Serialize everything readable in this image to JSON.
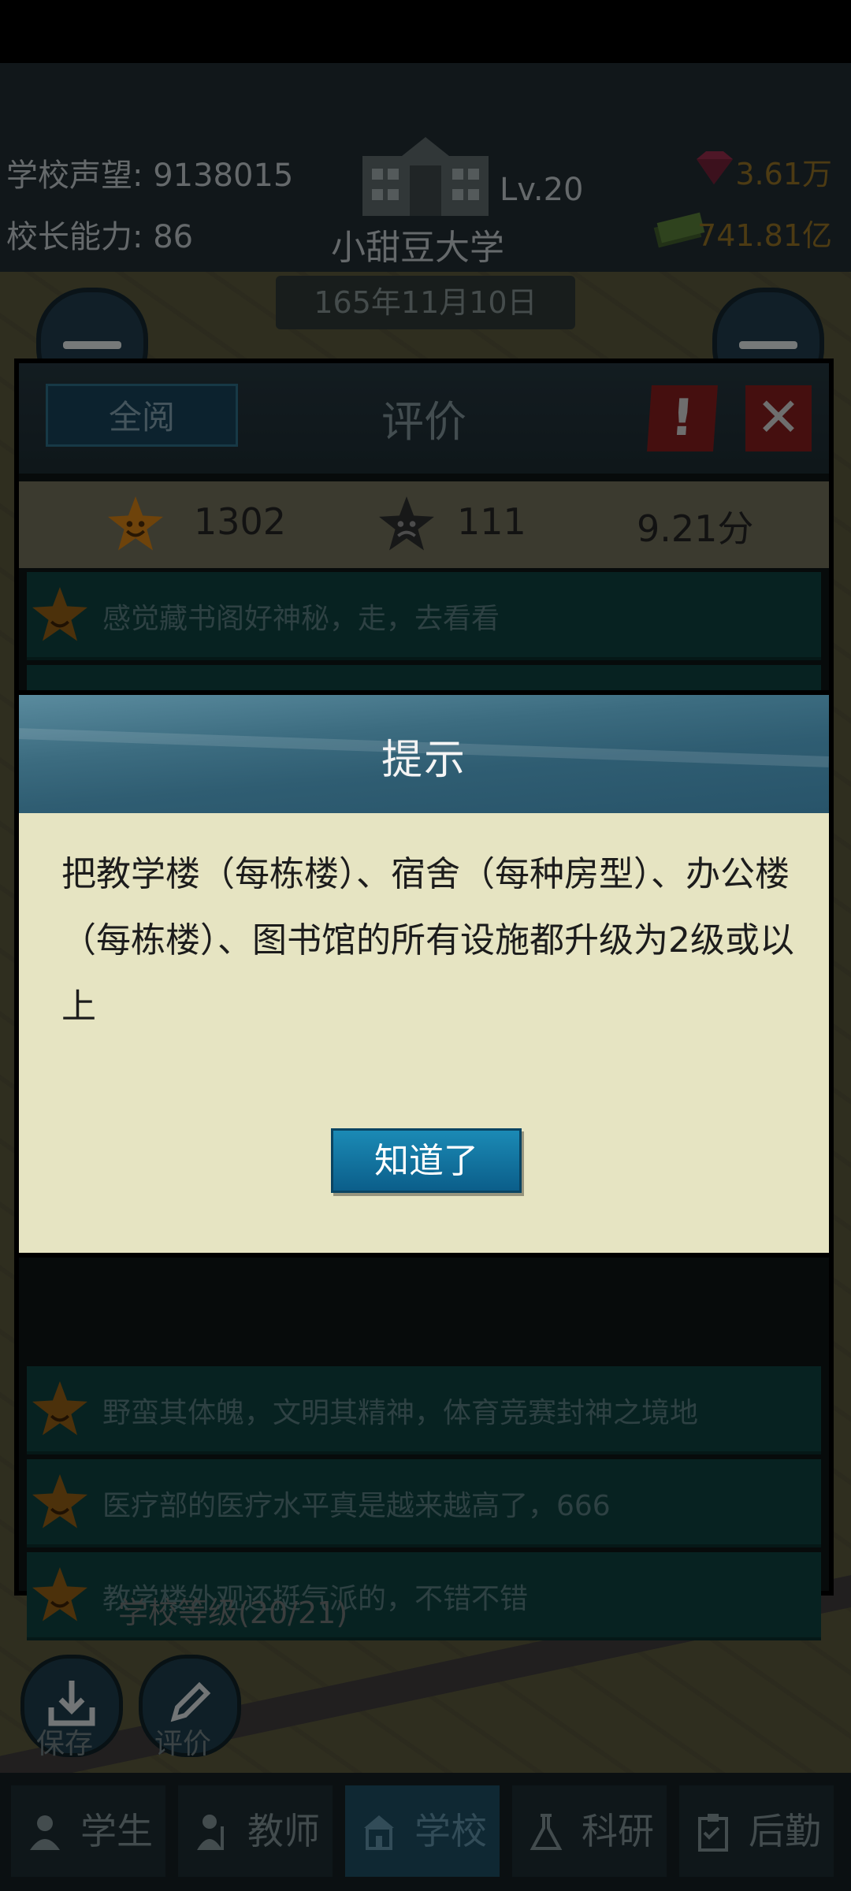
{
  "header": {
    "reputation_label": "学校声望: 9138015",
    "ability_label": "校长能力: 86",
    "level": "Lv.20",
    "school_name": "小甜豆大学",
    "gems": "3.61万",
    "cash": "741.81亿",
    "date": "165年11月10日"
  },
  "review_panel": {
    "read_all": "全阅",
    "title": "评价",
    "warning": "!",
    "close": "✕",
    "good_count": "1302",
    "bad_count": "111",
    "score": "9.21分",
    "reviews": [
      "感觉藏书阁好神秘，走，去看看",
      "",
      "野蛮其体魄，文明其精神，体育竞赛封神之境地",
      "医疗部的医疗水平真是越来越高了，666",
      "教学楼外观还挺气派的，不错不错"
    ]
  },
  "dialog": {
    "title": "提示",
    "message": "把教学楼（每栋楼）、宿舍（每种房型）、办公楼（每栋楼）、图书馆的所有设施都升级为2级或以上",
    "ok_label": "知道了"
  },
  "bottom": {
    "school_level": "学校等级(20/21)",
    "save_label": "保存",
    "review_label": "评价"
  },
  "tabs": [
    {
      "label": "学生",
      "icon": "student-icon"
    },
    {
      "label": "教师",
      "icon": "teacher-icon"
    },
    {
      "label": "学校",
      "icon": "school-icon"
    },
    {
      "label": "科研",
      "icon": "flask-icon"
    },
    {
      "label": "后勤",
      "icon": "clipboard-icon"
    }
  ],
  "active_tab": "学校",
  "colors": {
    "accent": "#1b8ab5",
    "dialog_bg": "#e6e4c2",
    "panel_row": "#0e3f3d",
    "danger": "#7e1d1d"
  }
}
